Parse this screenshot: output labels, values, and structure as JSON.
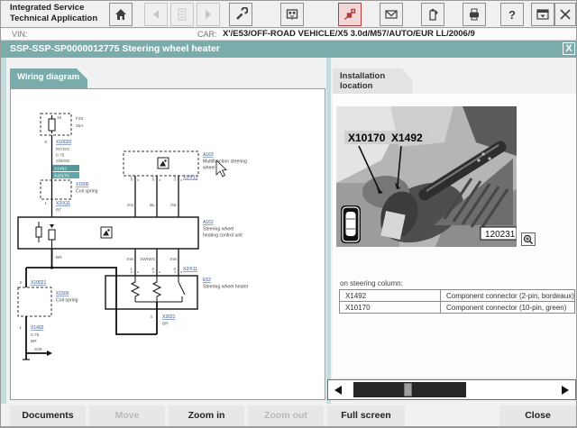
{
  "app": {
    "title_line1": "Integrated Service",
    "title_line2": "Technical Application"
  },
  "vehicle_bar": {
    "vin_label": "VIN:",
    "car_label": "CAR:",
    "car_value": "X'/E53/OFF-ROAD VEHICLE/X5 3.0d/M57/AUTO/EUR LL/2006/9"
  },
  "doc_bar": {
    "title": "SSP-SSP-SP0000012775 Steering wheel heater",
    "close_glyph": "X"
  },
  "tabs": {
    "wiring": "Wiring diagram",
    "installation_line1": "Installation",
    "installation_line2": "location"
  },
  "wiring": {
    "fuse_terminal": "15",
    "fuse_id": "F20",
    "fuse_rating": "30A",
    "pin_fuse": "6",
    "link_fuse": "X10020",
    "wire_top_1": "RT/GN",
    "wire_top_2": "0.75",
    "wire_top_3": "GN/GE",
    "hl_conn_1": "X1492",
    "hl_conn_2": "X10170",
    "coil1_link": "X1500",
    "coil1_name": "Coil spring",
    "pin_coil1": "1",
    "link_coil1": "X2/X11",
    "wire_coil1": "RT",
    "mfsw_link": "A163",
    "mfsw_name1": "Multifunction steering",
    "mfsw_name2": "wheel",
    "mfsw_pin1": "1",
    "mfsw_pin2": "2",
    "mfsw_pin3": "3",
    "mfsw_pins_link": "X2/X12",
    "mfsw_wire1": "GN",
    "mfsw_wire2": "BL",
    "mfsw_wire3": "GE",
    "ctrl_link": "A162",
    "ctrl_name1": "Steering wheel",
    "ctrl_name2": "heating control unit",
    "ctrl_gnd_wire": "BR",
    "out_wire1": "SW",
    "out_wire2": "SW/WS",
    "out_wire3": "SW",
    "out_pin1": "1",
    "out_pin2": "2",
    "out_pin3": "3",
    "out_pins_link": "X2/X11",
    "heater_link": "E52",
    "heater_name": "Steering wheel heater",
    "heater_pin": "4",
    "heater_pin_link": "X2021",
    "heater_wire": "BR",
    "pin_coil2_top": "2",
    "link_coil2_top": "X10021",
    "coil2_link": "X1500",
    "coil2_name": "Coil spring",
    "pin_coil2_bot": "1",
    "link_coil2_bot": "X1492",
    "wire_gnd_1": "0.75",
    "wire_gnd_2": "BR",
    "gnd_point": "S28"
  },
  "installation": {
    "photo_label_left": "X10170",
    "photo_label_right": "X1492",
    "photo_id": "120231",
    "caption": "on steering column:",
    "rows": [
      {
        "id": "X1492",
        "desc": "Component connector (2-pin, bordeaux)"
      },
      {
        "id": "X10170",
        "desc": "Component connector (10-pin, green)"
      }
    ]
  },
  "footer": {
    "buttons": [
      {
        "label": "Documents",
        "enabled": true
      },
      {
        "label": "Move",
        "enabled": false
      },
      {
        "label": "Zoom in",
        "enabled": true
      },
      {
        "label": "Zoom out",
        "enabled": false
      },
      {
        "label": "Full screen",
        "enabled": true
      },
      {
        "label": "Close",
        "enabled": true
      }
    ]
  },
  "colors": {
    "teal": "#7aacac",
    "link_blue": "#2b4fa0",
    "highlight_teal": "#4f9a9a",
    "alert_red": "#b23b3b"
  }
}
